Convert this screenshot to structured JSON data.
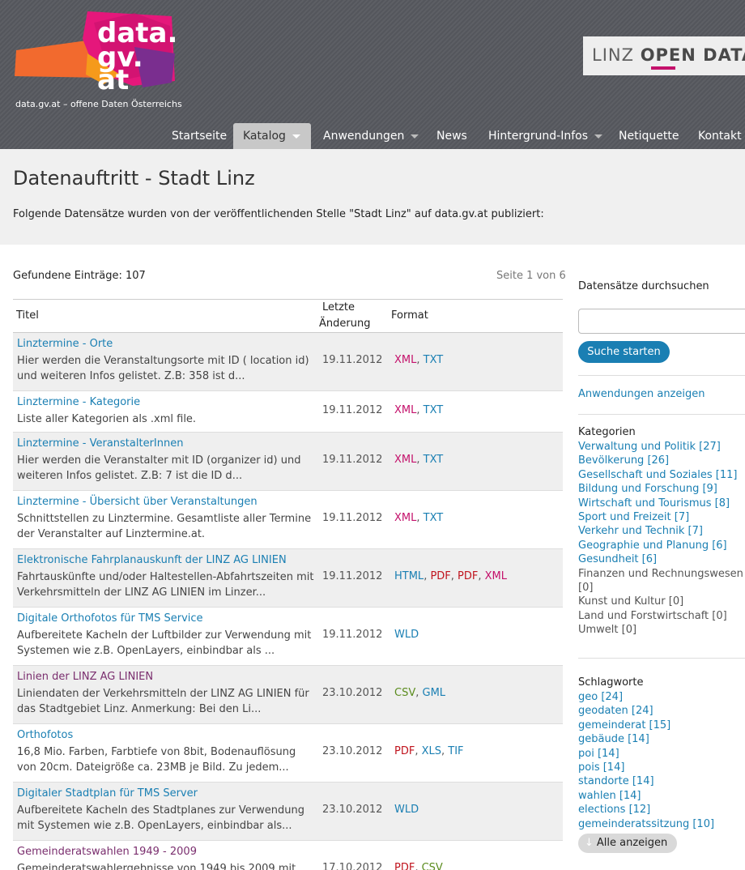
{
  "header": {
    "logo_text": "data.gv.at",
    "tagline": "data.gv.at – offene Daten Österreichs",
    "linz_logo_prefix": "LINZ",
    "linz_logo_suffix": "OPEN DATA"
  },
  "nav": {
    "items": [
      {
        "label": "Startseite"
      },
      {
        "label": "Katalog"
      },
      {
        "label": "Anwendungen"
      },
      {
        "label": "News"
      },
      {
        "label": "Hintergrund-Infos"
      },
      {
        "label": "Netiquette"
      },
      {
        "label": "Kontakt"
      }
    ]
  },
  "page": {
    "title": "Datenauftritt - Stadt Linz",
    "intro": "Folgende Datensätze wurden von der veröffentlichenden Stelle \"Stadt Linz\" auf data.gv.at publiziert:",
    "found": "Gefundene Einträge: 107",
    "pager": "Seite 1 von 6"
  },
  "table": {
    "headers": {
      "title": "Titel",
      "changed_1": "Letzte",
      "changed_2": "Änderung",
      "format": "Format"
    },
    "rows": [
      {
        "title": "Linztermine - Orte",
        "desc": "Hier werden die Veranstaltungsorte mit ID ( location id) und weiteren Infos gelistet. Z.B: 358 ist d...",
        "date": "19.11.2012",
        "f": [
          "XML",
          ", ",
          "TXT",
          "",
          "",
          "",
          ""
        ]
      },
      {
        "title": "Linztermine - Kategorie",
        "desc": "Liste aller Kategorien als .xml file.",
        "date": "19.11.2012",
        "f": [
          "XML",
          ", ",
          "TXT",
          "",
          "",
          "",
          ""
        ]
      },
      {
        "title": "Linztermine - VeranstalterInnen",
        "desc": "Hier werden die Veranstalter mit ID (organizer id) und weiteren Infos gelistet. Z.B: 7 ist die ID d...",
        "date": "19.11.2012",
        "f": [
          "XML",
          ", ",
          "TXT",
          "",
          "",
          "",
          ""
        ]
      },
      {
        "title": "Linztermine - Übersicht über Veranstaltungen",
        "desc": "Schnittstellen zu Linztermine. Gesamtliste aller Termine der Veranstalter auf Linztermine.at.",
        "date": "19.11.2012",
        "f": [
          "XML",
          ", ",
          "TXT",
          "",
          "",
          "",
          ""
        ]
      },
      {
        "title": "Elektronische Fahrplanauskunft der LINZ AG LINIEN",
        "desc": "Fahrtauskünfte und/oder Haltestellen-Abfahrtszeiten mit Verkehrsmitteln der LINZ AG LINIEN im Linzer...",
        "date": "19.11.2012",
        "f": [
          "HTML",
          ", ",
          "PDF",
          ", ",
          "PDF",
          ", ",
          "XML"
        ]
      },
      {
        "title": "Digitale Orthofotos für TMS Service",
        "desc": "Aufbereitete Kacheln der Luftbilder zur Verwendung mit Systemen wie z.B. OpenLayers, einbindbar als ...",
        "date": "19.11.2012",
        "f": [
          "WLD",
          "",
          "",
          "",
          "",
          "",
          ""
        ]
      },
      {
        "title": "Linien der LINZ AG LINIEN",
        "desc": "Liniendaten der Verkehrsmitteln der LINZ AG LINIEN für das Stadtgebiet Linz. Anmerkung: Bei den Li...",
        "date": "23.10.2012",
        "f": [
          "CSV",
          ", ",
          "GML",
          "",
          "",
          "",
          ""
        ]
      },
      {
        "title": "Orthofotos",
        "desc": "16,8 Mio. Farben, Farbtiefe von 8bit, Bodenauflösung von 20cm. Dateigröße ca. 23MB je Bild. Zu jedem...",
        "date": "23.10.2012",
        "f": [
          "PDF",
          ", ",
          "XLS",
          ", ",
          "TIF",
          "",
          ""
        ]
      },
      {
        "title": "Digitaler Stadtplan für TMS Server",
        "desc": "Aufbereitete Kacheln des Stadtplanes zur Verwendung mit Systemen wie z.B. OpenLayers, einbindbar als...",
        "date": "23.10.2012",
        "f": [
          "WLD",
          "",
          "",
          "",
          "",
          "",
          ""
        ]
      },
      {
        "title": "Gemeinderatswahlen 1949 - 2009",
        "desc": "Gemeinderatswahlergebnisse von 1949 bis 2009 mit",
        "date": "17.10.2012",
        "f": [
          "PDF",
          ", ",
          "CSV",
          "",
          "",
          "",
          ""
        ]
      }
    ]
  },
  "sidebar": {
    "search_heading": "Datensätze durchsuchen",
    "search_value": "",
    "search_button": "Suche starten",
    "apps_link": "Anwendungen anzeigen",
    "categories_heading": "Kategorien",
    "categories": [
      "Verwaltung und Politik [27]",
      "Bevölkerung [26]",
      "Gesellschaft und Soziales [11]",
      "Bildung und Forschung [9]",
      "Wirtschaft und Tourismus [8]",
      "Sport und Freizeit [7]",
      "Verkehr und Technik [7]",
      "Geographie und Planung [6]",
      "Gesundheit [6]",
      "Finanzen und Rechnungswesen",
      "[0]",
      "Kunst und Kultur [0]",
      "Land und Forstwirtschaft [0]",
      "Umwelt [0]"
    ],
    "tags_heading": "Schlagworte",
    "tags": [
      "geo [24]",
      "geodaten [24]",
      "gemeinderat [15]",
      "gebäude [14]",
      "poi [14]",
      "pois [14]",
      "standorte [14]",
      "wahlen [14]",
      "elections [12]",
      "gemeinderatssitzung [10]"
    ],
    "show_all": "Alle anzeigen"
  },
  "colors": {
    "link": "#1a7fb3",
    "visited": "#7a2e6e",
    "brand_magenta": "#c4116b",
    "header_bg": "#57595f"
  }
}
